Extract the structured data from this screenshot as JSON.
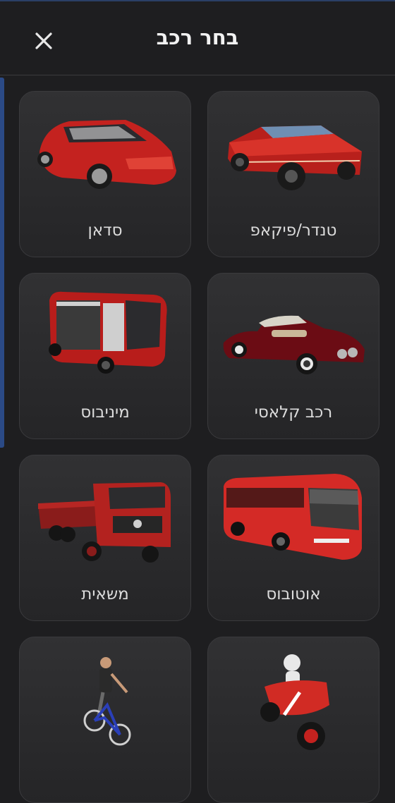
{
  "header": {
    "title": "בחר רכב",
    "close_icon": "close-icon"
  },
  "vehicles": [
    {
      "label": "טנדר/פיקאפ",
      "icon": "pickup-truck-image"
    },
    {
      "label": "סדאן",
      "icon": "sedan-car-image"
    },
    {
      "label": "רכב קלאסי",
      "icon": "classic-car-image"
    },
    {
      "label": "מיניבוס",
      "icon": "minibus-image"
    },
    {
      "label": "אוטובוס",
      "icon": "bus-image"
    },
    {
      "label": "משאית",
      "icon": "truck-image"
    },
    {
      "label": "",
      "icon": "motorcycle-image"
    },
    {
      "label": "",
      "icon": "bicycle-image"
    }
  ],
  "colors": {
    "accent": "#2b4a86",
    "vehicle_red": "#c4221f",
    "card_bg": "#2e2e30",
    "page_bg": "#1e1e20"
  }
}
